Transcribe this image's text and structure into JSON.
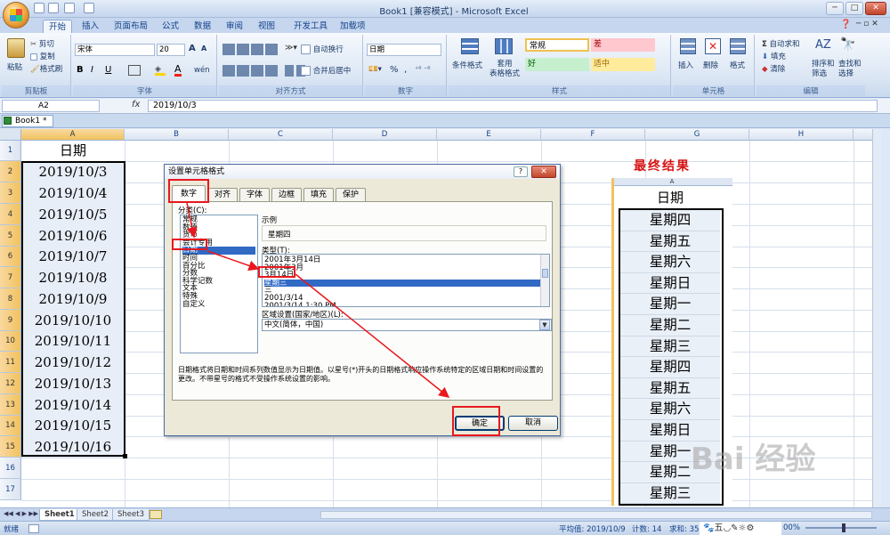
{
  "window": {
    "title": "Book1  [兼容模式] - Microsoft Excel",
    "min": "─",
    "max": "□",
    "close": "✕"
  },
  "tabs": [
    "开始",
    "插入",
    "页面布局",
    "公式",
    "数据",
    "审阅",
    "视图",
    "开发工具",
    "加载项"
  ],
  "ribbon": {
    "clipboard": {
      "paste": "粘贴",
      "cut": "剪切",
      "copy": "复制",
      "format_painter": "格式刷",
      "label": "剪贴板"
    },
    "font": {
      "name": "宋体",
      "size": "20",
      "bold": "B",
      "italic": "I",
      "underline": "U",
      "grow": "A",
      "shrink": "A",
      "label": "字体",
      "wen": "wén"
    },
    "align": {
      "wrap": "自动换行",
      "merge": "合并后居中",
      "label": "对齐方式"
    },
    "number": {
      "format": "日期",
      "percent": "%",
      "comma": ",",
      "label": "数字"
    },
    "styles": {
      "conditional": "条件格式",
      "table": "套用\n表格格式",
      "normal": "常规",
      "bad": "差",
      "good": "好",
      "neutral": "适中",
      "label": "样式"
    },
    "cells": {
      "insert": "插入",
      "delete": "删除",
      "format": "格式",
      "label": "单元格"
    },
    "editing": {
      "autosum": "自动求和",
      "fill": "填充",
      "clear": "清除",
      "sort": "排序和\n筛选",
      "find": "查找和\n选择",
      "label": "编辑"
    }
  },
  "formula_bar": {
    "name_box": "A2",
    "fx": "fx",
    "value": "2019/10/3"
  },
  "workbook_tab": "Book1 *",
  "columns": [
    "A",
    "B",
    "C",
    "D",
    "E",
    "F",
    "G",
    "H"
  ],
  "rows": [
    "1",
    "2",
    "3",
    "4",
    "5",
    "6",
    "7",
    "8",
    "9",
    "10",
    "11",
    "12",
    "13",
    "14",
    "15",
    "16",
    "17"
  ],
  "column_a": [
    "日期",
    "2019/10/3",
    "2019/10/4",
    "2019/10/5",
    "2019/10/6",
    "2019/10/7",
    "2019/10/8",
    "2019/10/9",
    "2019/10/10",
    "2019/10/11",
    "2019/10/12",
    "2019/10/13",
    "2019/10/14",
    "2019/10/15",
    "2019/10/16"
  ],
  "result": {
    "title": "最终结果",
    "col_header": "A",
    "header": "日期",
    "values": [
      "星期四",
      "星期五",
      "星期六",
      "星期日",
      "星期一",
      "星期二",
      "星期三",
      "星期四",
      "星期五",
      "星期六",
      "星期日",
      "星期一",
      "星期二",
      "星期三"
    ]
  },
  "dialog": {
    "title": "设置单元格格式",
    "help": "?",
    "close": "✕",
    "tabs": [
      "数字",
      "对齐",
      "字体",
      "边框",
      "填充",
      "保护"
    ],
    "category_label": "分类(C):",
    "categories": [
      "常规",
      "数值",
      "货币",
      "会计专用",
      "日期",
      "时间",
      "百分比",
      "分数",
      "科学记数",
      "文本",
      "特殊",
      "自定义"
    ],
    "sample_label": "示例",
    "sample_value": "星期四",
    "type_label": "类型(T):",
    "types": [
      "2001年3月14日",
      "2001年3月",
      "3月14日",
      "星期三",
      "三",
      "2001/3/14",
      "2001/3/14 1:30 PM"
    ],
    "locale_label": "区域设置(国家/地区)(L):",
    "locale_value": "中文(简体，中国)",
    "description": "日期格式将日期和时间系列数值显示为日期值。以星号(*)开头的日期格式响应操作系统特定的区域日期和时间设置的更改。不带星号的格式不受操作系统设置的影响。",
    "ok": "确定",
    "cancel": "取消"
  },
  "sheet_tabs": [
    "Sheet1",
    "Sheet2",
    "Sheet3"
  ],
  "status": {
    "ready": "就绪",
    "average": "平均值: 2019/10/9",
    "count": "计数: 14",
    "sum": "求和: 351",
    "zoom": "00%"
  },
  "watermark": "Bai 经验"
}
